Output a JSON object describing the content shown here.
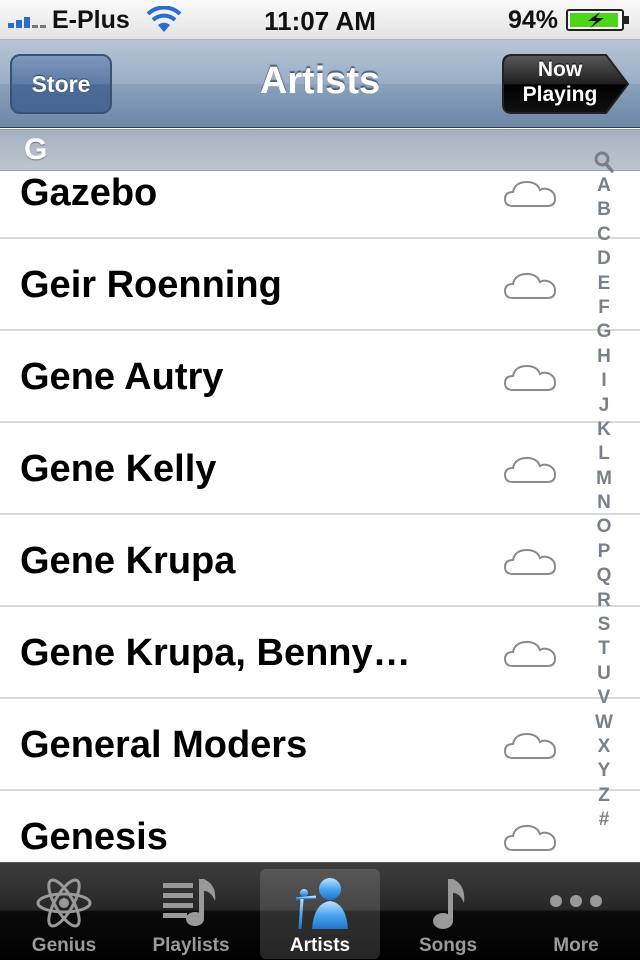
{
  "status_bar": {
    "carrier": "E-Plus",
    "time": "11:07 AM",
    "battery_percent": "94%",
    "signal_icon": "signal-bars-icon",
    "wifi_icon": "wifi-icon",
    "battery_icon": "battery-charging-icon"
  },
  "nav": {
    "store_label": "Store",
    "title": "Artists",
    "now_playing_line1": "Now",
    "now_playing_line2": "Playing"
  },
  "section": {
    "header": "G"
  },
  "artists": [
    {
      "name": "Gazebo",
      "icon": "cloud-icon"
    },
    {
      "name": "Geir Roenning",
      "icon": "cloud-icon"
    },
    {
      "name": "Gene Autry",
      "icon": "cloud-icon"
    },
    {
      "name": "Gene Kelly",
      "icon": "cloud-icon"
    },
    {
      "name": "Gene Krupa",
      "icon": "cloud-icon"
    },
    {
      "name": "Gene Krupa, Benny…",
      "icon": "cloud-icon"
    },
    {
      "name": "General Moders",
      "icon": "cloud-icon"
    },
    {
      "name": "Genesis",
      "icon": "cloud-icon"
    }
  ],
  "index": {
    "search_icon": "search-icon",
    "letters": [
      "A",
      "B",
      "C",
      "D",
      "E",
      "F",
      "G",
      "H",
      "I",
      "J",
      "K",
      "L",
      "M",
      "N",
      "O",
      "P",
      "Q",
      "R",
      "S",
      "T",
      "U",
      "V",
      "W",
      "X",
      "Y",
      "Z",
      "#"
    ]
  },
  "tabs": [
    {
      "label": "Genius",
      "icon": "atom-icon"
    },
    {
      "label": "Playlists",
      "icon": "playlist-icon"
    },
    {
      "label": "Artists",
      "icon": "artist-microphone-icon",
      "selected": true
    },
    {
      "label": "Songs",
      "icon": "music-note-icon"
    },
    {
      "label": "More",
      "icon": "more-dots-icon"
    }
  ],
  "colors": {
    "nav_blue": "#6d87a8",
    "index_gray": "#7a7f8c",
    "tab_selected_blue": "#2f8fe6",
    "battery_green": "#4cd61a"
  }
}
